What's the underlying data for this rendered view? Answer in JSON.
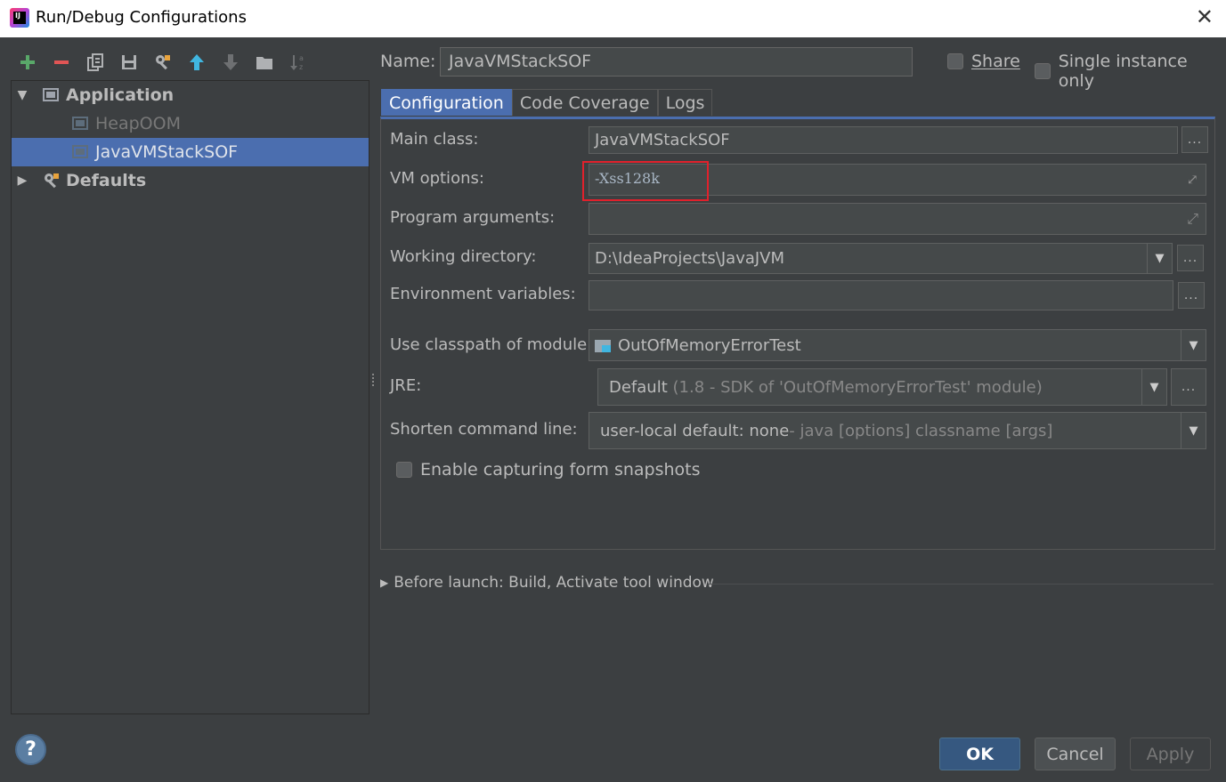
{
  "window": {
    "title": "Run/Debug Configurations",
    "close_glyph": "✕"
  },
  "toolbar": {
    "icons": [
      "add-icon",
      "remove-icon",
      "copy-icon",
      "save-icon",
      "edit-defaults-icon",
      "move-up-icon",
      "move-down-icon",
      "folder-icon",
      "sort-icon"
    ],
    "colors": {
      "add": "#59a869",
      "remove": "#e05555",
      "up": "#40b6e0"
    }
  },
  "tree": {
    "application_label": "Application",
    "items": [
      {
        "label": "HeapOOM",
        "selected": false
      },
      {
        "label": "JavaVMStackSOF",
        "selected": true
      }
    ],
    "defaults_label": "Defaults"
  },
  "name": {
    "label": "Name:",
    "value": "JavaVMStackSOF"
  },
  "share": {
    "label": "Share",
    "checked": false
  },
  "single_instance": {
    "label": "Single instance only",
    "checked": false
  },
  "tabs": [
    {
      "label": "Configuration",
      "active": true
    },
    {
      "label": "Code Coverage",
      "active": false
    },
    {
      "label": "Logs",
      "active": false
    }
  ],
  "form": {
    "main_class": {
      "label": "Main class:",
      "value": "JavaVMStackSOF"
    },
    "vm_options": {
      "label": "VM options:",
      "value": "-Xss128k"
    },
    "program_arguments": {
      "label": "Program arguments:",
      "value": ""
    },
    "working_directory": {
      "label": "Working directory:",
      "value": "D:\\IdeaProjects\\JavaJVM"
    },
    "environment_variables": {
      "label": "Environment variables:",
      "value": ""
    },
    "classpath_module": {
      "label": "Use classpath of module:",
      "value": "OutOfMemoryErrorTest"
    },
    "jre": {
      "label": "JRE:",
      "value": "Default",
      "detail": "(1.8 - SDK of 'OutOfMemoryErrorTest' module)"
    },
    "shorten_command_line": {
      "label": "Shorten command line:",
      "value": "user-local default: none",
      "detail": " - java [options] classname [args]"
    },
    "capture_snapshots": {
      "label": "Enable capturing form snapshots",
      "checked": false
    },
    "ellipsis": "..."
  },
  "before_launch": {
    "label": "Before launch: Build, Activate tool window"
  },
  "buttons": {
    "help": "?",
    "ok": "OK",
    "cancel": "Cancel",
    "apply": "Apply"
  },
  "highlight_color": "#e0212c",
  "selection_color": "#4b6eaf"
}
